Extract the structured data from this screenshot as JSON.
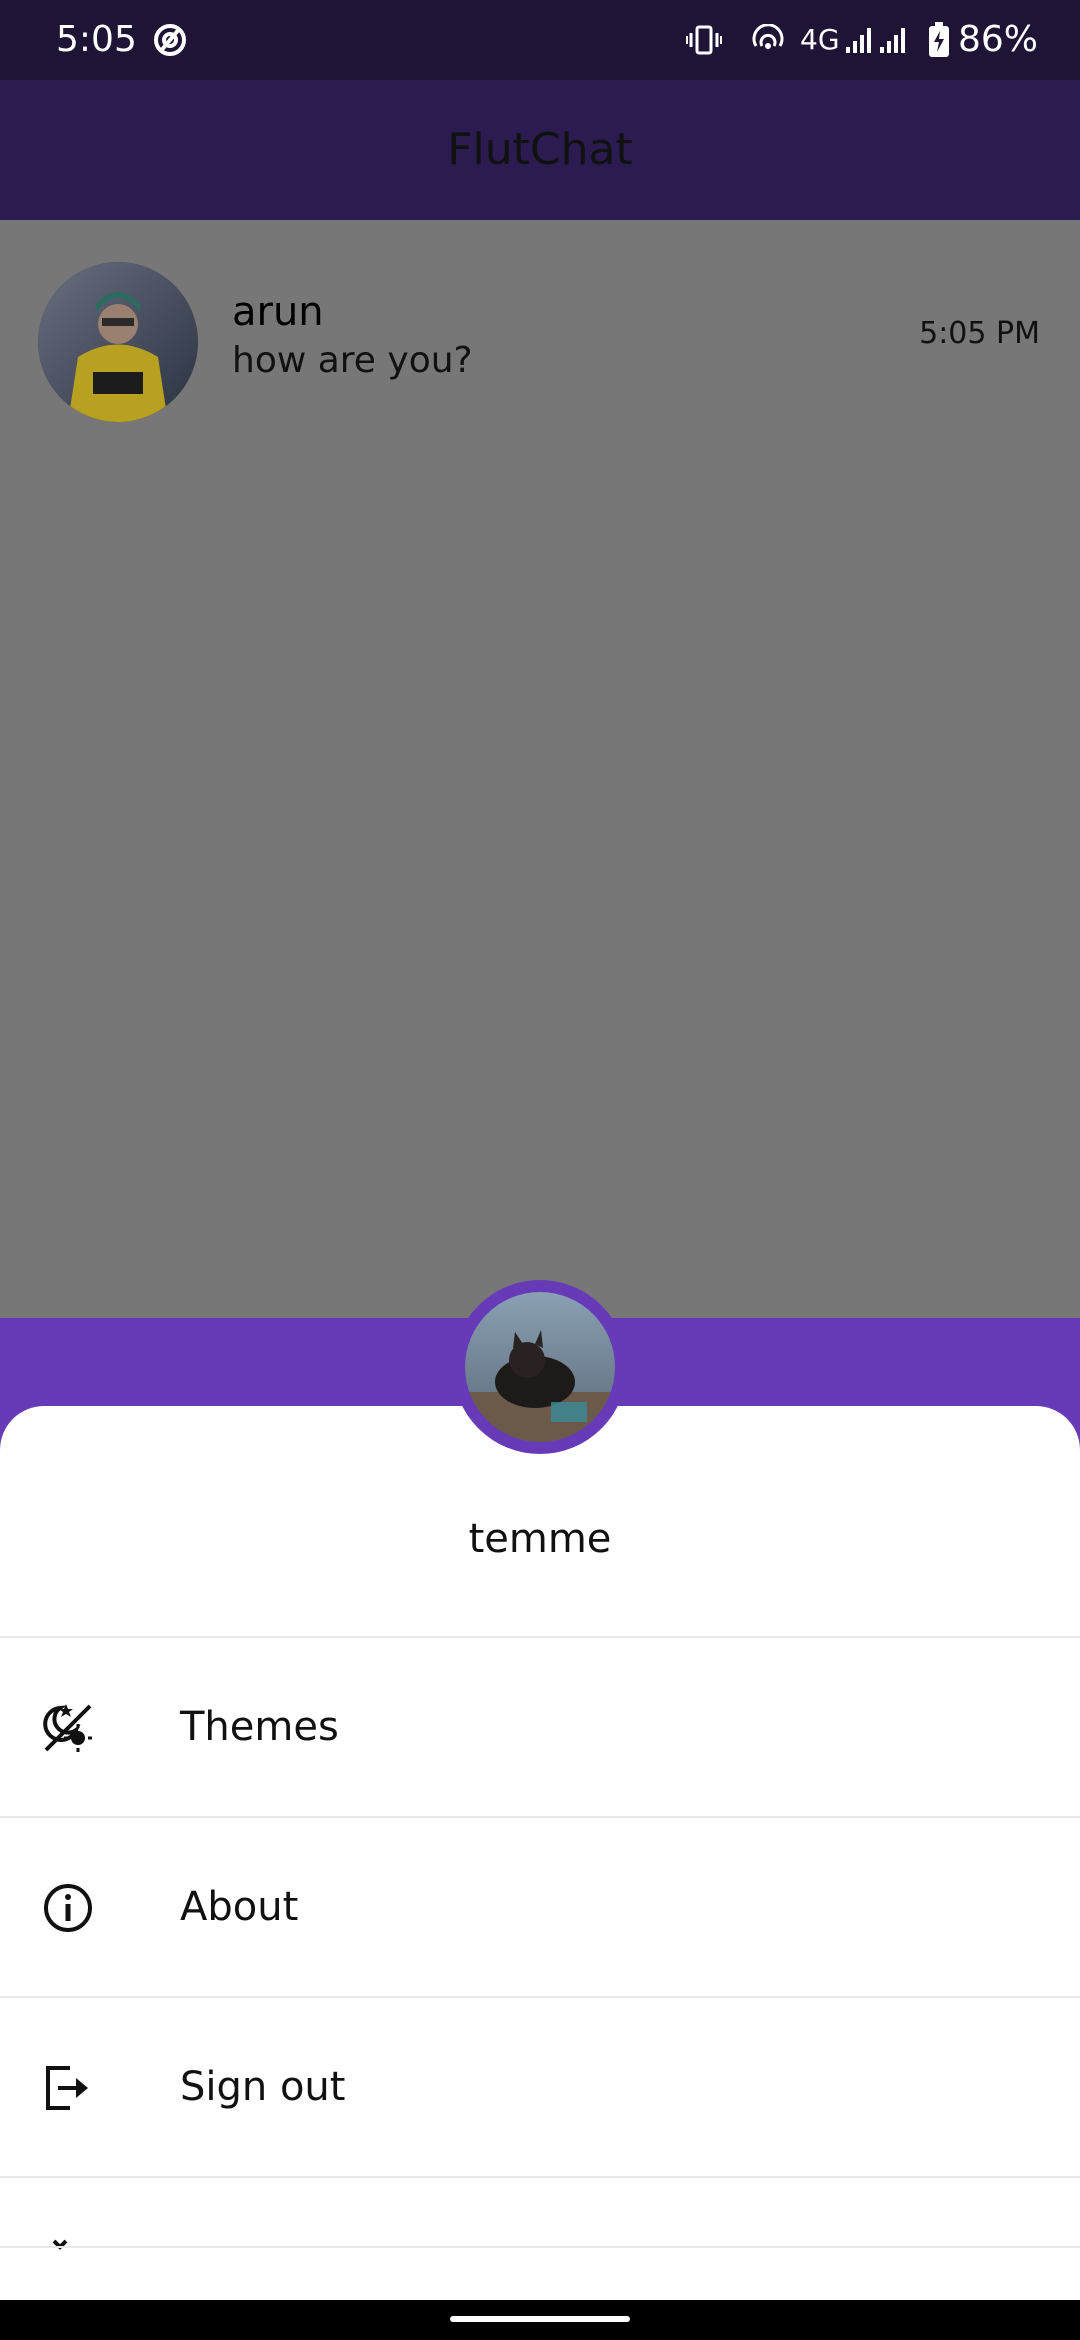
{
  "status_bar": {
    "time": "5:05",
    "network": "4G",
    "battery": "86%",
    "icons": [
      "hotspot-icon",
      "vibrate-icon",
      "wifi-calling-icon",
      "signal-icon",
      "battery-charging-icon"
    ]
  },
  "app_bar": {
    "title": "FlutChat"
  },
  "chats": [
    {
      "name": "arun",
      "preview": "how are you?",
      "time": "5:05 PM"
    }
  ],
  "sheet": {
    "profile_name": "temme",
    "menu": [
      {
        "label": "Themes",
        "icon": "theme-toggle-icon"
      },
      {
        "label": "About",
        "icon": "info-icon"
      },
      {
        "label": "Sign out",
        "icon": "sign-out-icon"
      }
    ]
  },
  "colors": {
    "status_bar": "#201436",
    "app_bar": "#2c1b50",
    "accent": "#673ab7",
    "scrim": "#777777",
    "sheet": "#ffffff"
  }
}
